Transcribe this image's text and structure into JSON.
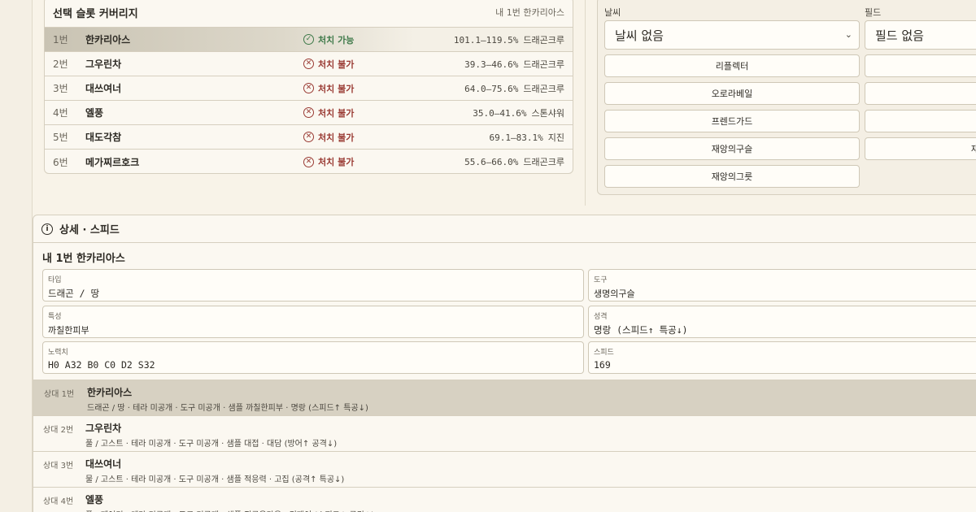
{
  "coverage": {
    "title": "선택 슬롯 커버리지",
    "subtitle": "내 1번 한카리아스",
    "rows": [
      {
        "num": "1번",
        "name": "한카리아스",
        "status": "처치 가능",
        "ok": true,
        "range": "101.1–119.5%",
        "unit": "드래곤크루"
      },
      {
        "num": "2번",
        "name": "그우린차",
        "status": "처치 불가",
        "ok": false,
        "range": "39.3–46.6%",
        "unit": "드래곤크루"
      },
      {
        "num": "3번",
        "name": "대쓰여너",
        "status": "처치 불가",
        "ok": false,
        "range": "64.0–75.6%",
        "unit": "드래곤크루"
      },
      {
        "num": "4번",
        "name": "엘풍",
        "status": "처치 불가",
        "ok": false,
        "range": "35.0–41.6%",
        "unit": "스톤샤워"
      },
      {
        "num": "5번",
        "name": "대도각참",
        "status": "처치 불가",
        "ok": false,
        "range": "69.1–83.1%",
        "unit": "지진"
      },
      {
        "num": "6번",
        "name": "메가찌르호크",
        "status": "처치 불가",
        "ok": false,
        "range": "55.6–66.0%",
        "unit": "드래곤크루"
      }
    ]
  },
  "conditions": {
    "weather_label": "날씨",
    "weather_value": "날씨 없음",
    "field_label": "필드",
    "field_value": "필드 없음",
    "buttons_left": [
      "리플렉터",
      "오로라베일",
      "프렌드가드",
      "재앙의구슬",
      "재앙의그릇"
    ],
    "buttons_right_visible": [
      "재"
    ]
  },
  "detail": {
    "header": "상세 · 스피드",
    "info_icon": "info-circle-icon",
    "subject": "내 1번 한카리아스",
    "fields": {
      "type_label": "타입",
      "type_value": "드래곤 / 땅",
      "item_label": "도구",
      "item_value": "생명의구슬",
      "ability_label": "특성",
      "ability_value": "까칠한피부",
      "nature_label": "성격",
      "nature_value": "명랑 (스피드↑ 특공↓)",
      "ev_label": "노력치",
      "ev_value": "H0 A32 B0 C0 D2 S32",
      "speed_label": "스피드",
      "speed_value": "169"
    },
    "opponents": [
      {
        "num": "상대 1번",
        "name": "한카리아스",
        "info": "드래곤 / 땅 · 테라 미공개 · 도구 미공개 · 샘플 까칠한피부 · 명랑 (스피드↑ 특공↓)",
        "active": true
      },
      {
        "num": "상대 2번",
        "name": "그우린차",
        "info": "풀 / 고스트 · 테라 미공개 · 도구 미공개 · 샘플 대접 · 대담 (방어↑ 공격↓)",
        "active": false
      },
      {
        "num": "상대 3번",
        "name": "대쓰여너",
        "info": "물 / 고스트 · 테라 미공개 · 도구 미공개 · 샘플 적응력 · 고집 (공격↑ 특공↓)",
        "active": false
      },
      {
        "num": "상대 4번",
        "name": "엘풍",
        "info": "풀 / 페어리 · 테라 미공개 · 도구 미공개 · 샘플 짓궂은마음 · 건재이 (스피드↑ 공격↓)",
        "active": false
      }
    ]
  },
  "colors": {
    "background": "#f8f3e8",
    "ok": "#3f7a4a",
    "no": "#9a3b34",
    "active_row": "#d7d1c2"
  }
}
